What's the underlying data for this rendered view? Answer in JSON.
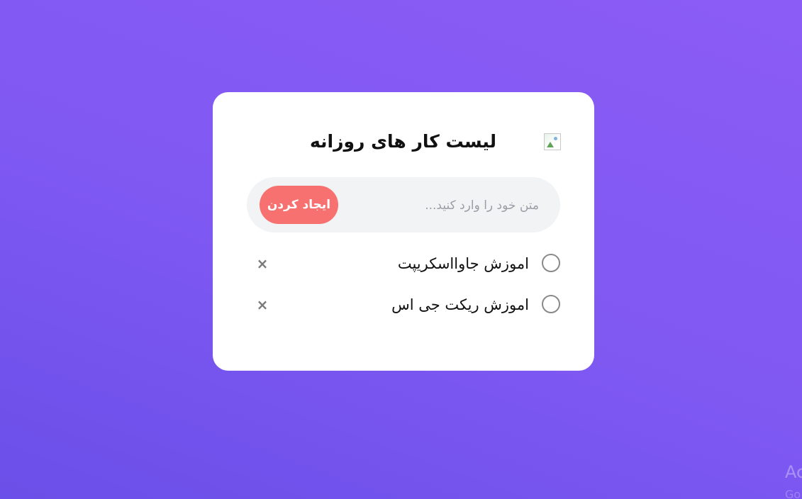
{
  "app": {
    "title": "لیست کار های روزانه",
    "logo_icon": "broken-image-icon"
  },
  "input": {
    "placeholder": "متن خود را وارد کنید...",
    "value": "",
    "button_label": "ایجاد کردن"
  },
  "tasks": [
    {
      "label": "اموزش جاوااسکریپت",
      "completed": false,
      "delete_icon": "×"
    },
    {
      "label": "اموزش ریکت جی اس",
      "completed": false,
      "delete_icon": "×"
    }
  ],
  "watermark": {
    "line1": "Ac",
    "line2": "Go"
  },
  "colors": {
    "background_start": "#6a4fe8",
    "background_end": "#8c5cf6",
    "button": "#f87171",
    "card": "#ffffff"
  }
}
